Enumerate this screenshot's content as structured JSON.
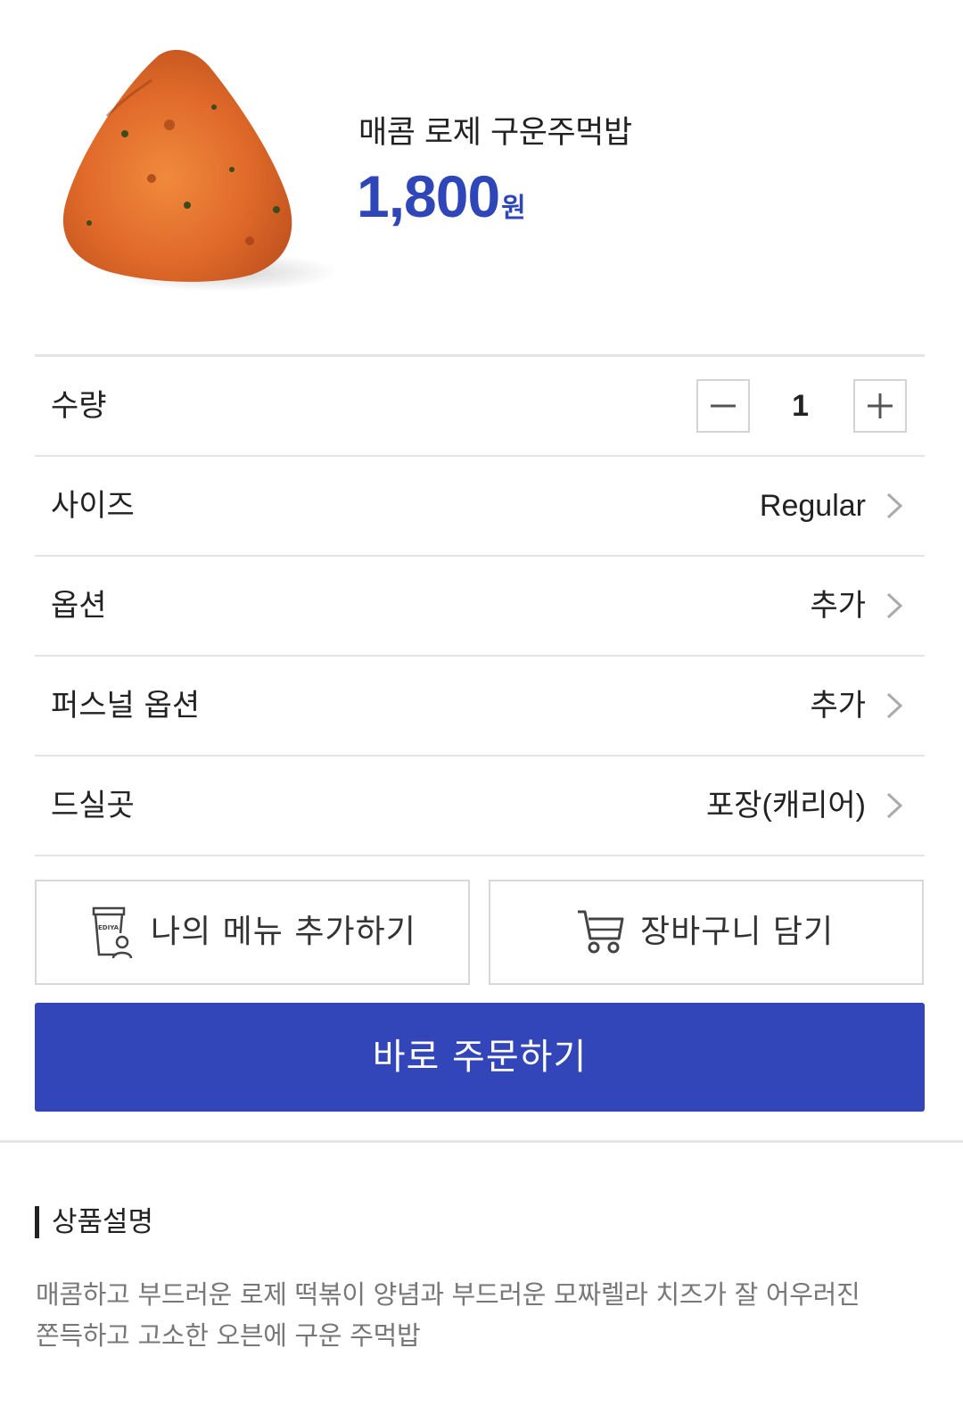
{
  "product": {
    "name": "매콤 로제 구운주먹밥",
    "price": "1,800",
    "price_unit": "원"
  },
  "rows": {
    "quantity": {
      "label": "수량",
      "value": "1"
    },
    "size": {
      "label": "사이즈",
      "value": "Regular"
    },
    "option": {
      "label": "옵션",
      "value": "추가"
    },
    "personal_option": {
      "label": "퍼스널 옵션",
      "value": "추가"
    },
    "dine_place": {
      "label": "드실곳",
      "value": "포장(캐리어)"
    }
  },
  "actions": {
    "my_menu": "나의 메뉴 추가하기",
    "cart": "장바구니 담기",
    "order_now": "바로 주문하기",
    "cup_icon_text": "EDIYA"
  },
  "description": {
    "title": "상품설명",
    "text_line1": "매콤하고 부드러운 로제 떡볶이 양념과 부드러운 모짜렐라 치즈가 잘 어우러진",
    "text_line2": "쫀득하고 고소한 오븐에 구운 주먹밥"
  },
  "colors": {
    "accent": "#3346b9",
    "price": "#2f46b8",
    "divider": "#e4e4e4"
  }
}
